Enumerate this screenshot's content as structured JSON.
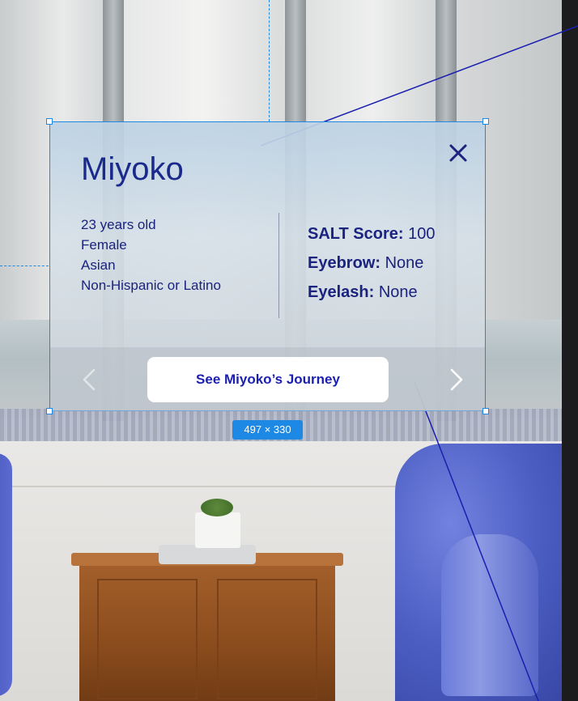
{
  "profile": {
    "name": "Miyoko",
    "demographics": [
      "23 years old",
      "Female",
      "Asian",
      "Non-Hispanic or Latino"
    ],
    "scores": [
      {
        "label": "SALT Score:",
        "value": "100"
      },
      {
        "label": "Eyebrow:",
        "value": "None"
      },
      {
        "label": "Eyelash:",
        "value": "None"
      }
    ]
  },
  "footer": {
    "cta_label": "See Miyoko’s Journey"
  },
  "selection": {
    "dimension_label": "497 × 330"
  },
  "icons": {
    "close": "close-icon",
    "prev": "chevron-left-icon",
    "next": "chevron-right-icon"
  },
  "colors": {
    "accent": "#1e88e5",
    "text_primary": "#1a237e",
    "cta_text": "#1a1fb0"
  }
}
